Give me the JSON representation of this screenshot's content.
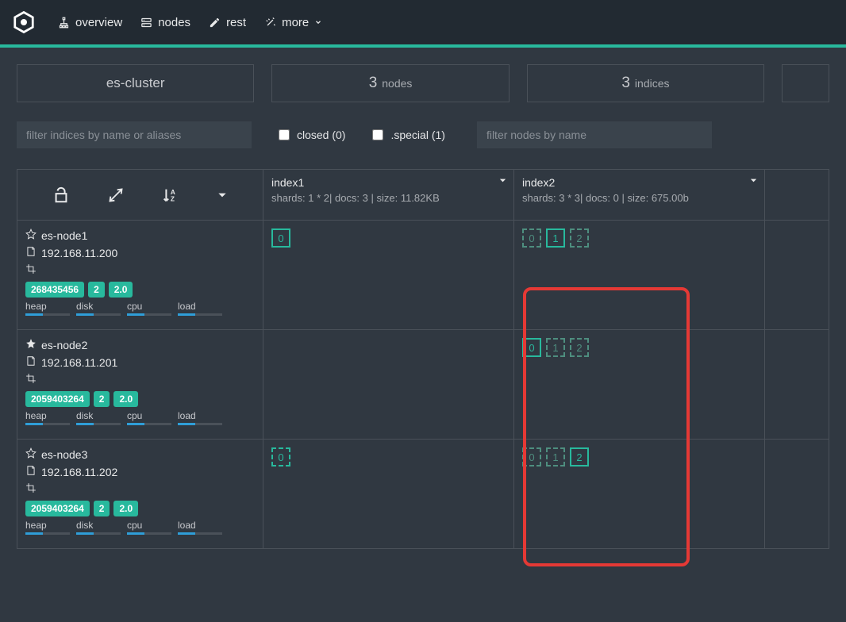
{
  "nav": {
    "overview": "overview",
    "nodes": "nodes",
    "rest": "rest",
    "more": "more"
  },
  "summary": {
    "cluster_name": "es-cluster",
    "nodes_count": "3",
    "nodes_label": "nodes",
    "indices_count": "3",
    "indices_label": "indices"
  },
  "filters": {
    "indices_placeholder": "filter indices by name or aliases",
    "closed_label": "closed (0)",
    "special_label": ".special (1)",
    "nodes_placeholder": "filter nodes by name"
  },
  "indices": [
    {
      "name": "index1",
      "stats": "shards: 1 * 2| docs: 3 | size: 11.82KB"
    },
    {
      "name": "index2",
      "stats": "shards: 3 * 3| docs: 0 | size: 675.00b"
    }
  ],
  "nodes": [
    {
      "name": "es-node1",
      "ip": "192.168.11.200",
      "master": false,
      "badges": [
        "268435456",
        "2",
        "2.0"
      ],
      "metrics": [
        "heap",
        "disk",
        "cpu",
        "load"
      ],
      "shards_index1": [
        {
          "id": "0",
          "style": "solid"
        }
      ],
      "shards_index2": [
        {
          "id": "0",
          "style": "dashed-mut"
        },
        {
          "id": "1",
          "style": "solid"
        },
        {
          "id": "2",
          "style": "dashed-mut"
        }
      ]
    },
    {
      "name": "es-node2",
      "ip": "192.168.11.201",
      "master": true,
      "badges": [
        "2059403264",
        "2",
        "2.0"
      ],
      "metrics": [
        "heap",
        "disk",
        "cpu",
        "load"
      ],
      "shards_index1": [],
      "shards_index2": [
        {
          "id": "0",
          "style": "solid"
        },
        {
          "id": "1",
          "style": "dashed-mut"
        },
        {
          "id": "2",
          "style": "dashed-mut"
        }
      ]
    },
    {
      "name": "es-node3",
      "ip": "192.168.11.202",
      "master": false,
      "badges": [
        "2059403264",
        "2",
        "2.0"
      ],
      "metrics": [
        "heap",
        "disk",
        "cpu",
        "load"
      ],
      "shards_index1": [
        {
          "id": "0",
          "style": "dashed"
        }
      ],
      "shards_index2": [
        {
          "id": "0",
          "style": "dashed-mut"
        },
        {
          "id": "1",
          "style": "dashed-mut"
        },
        {
          "id": "2",
          "style": "solid"
        }
      ]
    }
  ]
}
